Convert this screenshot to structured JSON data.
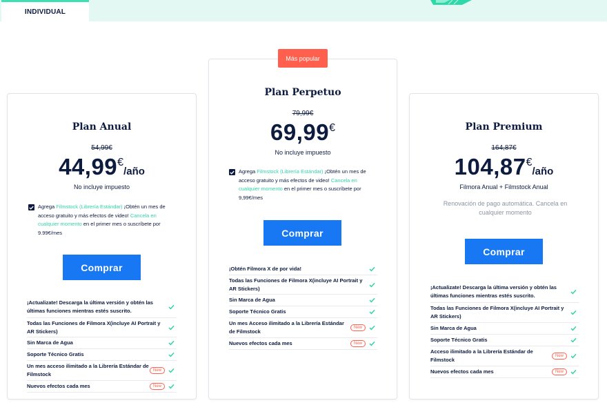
{
  "tabs": {
    "active": "INDIVIDUAL"
  },
  "colors": {
    "accent": "#31d3a6",
    "button": "#1877f2",
    "badge": "#ff5f4d",
    "text": "#0d1b3e"
  },
  "plans": {
    "anual": {
      "title": "Plan Anual",
      "old_price": "54,99€",
      "price": "44,99",
      "currency": "€",
      "period": "/año",
      "note": "No incluye impuesto",
      "checkbox": {
        "checked": true,
        "text_before": "Agrega ",
        "link1": "Filmstock (Librería Estándar)",
        "text_middle": " ¡Obtén un mes de acceso gratuito y más efectos de video! ",
        "link2": "Cancela en cualquier momento",
        "text_after": " en el primer mes o suscríbete por 9.99€/mes"
      },
      "buy_label": "Comprar",
      "features": [
        {
          "label": "¡Actualizate! Descarga la última versión y obtén las últimas funciones mientras estés suscrito.",
          "badge": ""
        },
        {
          "label": "Todas las Funciones de Filmora X(incluye AI Portrait y AR Stickers)",
          "badge": ""
        },
        {
          "label": "Sin Marca de Agua",
          "badge": ""
        },
        {
          "label": "Soporte Técnico Gratis",
          "badge": ""
        },
        {
          "label": "Un mes acceso ilimitado a la Librería Estándar de Filmstock",
          "badge": "New"
        },
        {
          "label": "Nuevos efectos cada mes",
          "badge": "New"
        }
      ]
    },
    "perpetuo": {
      "badge": "Más popular",
      "title": "Plan Perpetuo",
      "old_price": "79,99€",
      "price": "69,99",
      "currency": "€",
      "note": "No incluye impuesto",
      "checkbox": {
        "checked": true,
        "text_before": "Agrega ",
        "link1": "Filmstock (Librería Estándar)",
        "text_middle": " ¡Obtén un mes de acceso gratuito y más efectos de video! ",
        "link2": "Cancela en cualquier momento",
        "text_after": " en el primer mes o suscríbete por 9,99€/mes"
      },
      "buy_label": "Comprar",
      "features": [
        {
          "label": "¡Obtén Filmora X de por vida!",
          "badge": ""
        },
        {
          "label": "Todas las Funciones de Filmora X(incluye AI Portrait y AR Stickers)",
          "badge": ""
        },
        {
          "label": "Sin Marca de Agua",
          "badge": ""
        },
        {
          "label": "Soporte Técnico Gratis",
          "badge": ""
        },
        {
          "label": "Un mes Acceso ilimitado a la Librería Estándar de Filmstock",
          "badge": "New"
        },
        {
          "label": "Nuevos efectos cada mes",
          "badge": "New"
        }
      ]
    },
    "premium": {
      "title": "Plan Premium",
      "old_price": "164,87€",
      "price": "104,87",
      "currency": "€",
      "period": "/año",
      "note": "Filmora Anual + Filmstock Anual",
      "renewal": "Renovación de pago automática. Cancela en cualquier momento",
      "buy_label": "Comprar",
      "features": [
        {
          "label": "¡Actualizate! Descarga la última versión y obtén las últimas funciones mientras estés suscrito.",
          "badge": ""
        },
        {
          "label": "Todas las Funciones de Filmora X(incluye AI Portrait y AR Stickers)",
          "badge": ""
        },
        {
          "label": "Sin Marca de Agua",
          "badge": ""
        },
        {
          "label": "Soporte Técnico Gratis",
          "badge": ""
        },
        {
          "label": "Acceso ilimitado a la Librería Estándar de Filmstock",
          "badge": "New"
        },
        {
          "label": "Nuevos efectos cada mes",
          "badge": "New"
        }
      ]
    }
  }
}
